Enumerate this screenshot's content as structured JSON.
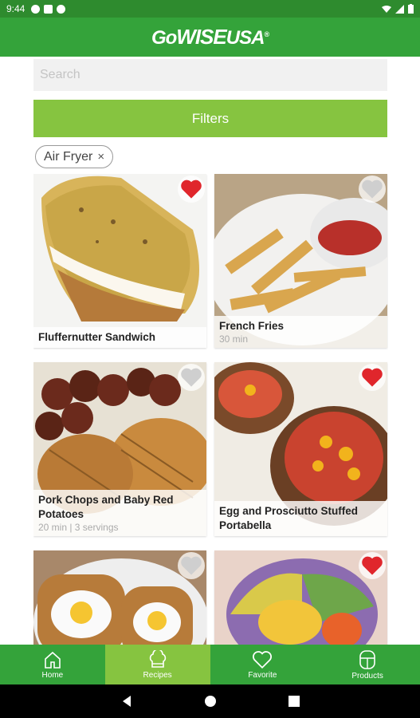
{
  "status": {
    "time": "9:44"
  },
  "app": {
    "logo_go": "Go",
    "logo_wise": "WISE",
    "logo_usa": "USA",
    "logo_mark": "®"
  },
  "search": {
    "placeholder": "Search"
  },
  "filters": {
    "label": "Filters"
  },
  "chip": {
    "label": "Air Fryer",
    "remove": "×"
  },
  "recipes": [
    {
      "title": "Fluffernutter Sandwich",
      "meta": "",
      "favorite": true,
      "icon": "heart-filled"
    },
    {
      "title": "French Fries",
      "meta": "30 min",
      "favorite": false,
      "icon": "heart-outline"
    },
    {
      "title": "Pork Chops and Baby Red Potatoes",
      "meta": "20 min | 3 servings",
      "favorite": false,
      "icon": "heart-outline"
    },
    {
      "title": "Egg and Prosciutto Stuffed Portabella",
      "meta": "",
      "favorite": true,
      "icon": "heart-filled"
    },
    {
      "title": "",
      "meta": "",
      "favorite": false,
      "icon": "heart-outline"
    },
    {
      "title": "",
      "meta": "",
      "favorite": true,
      "icon": "heart-filled"
    }
  ],
  "nav": {
    "items": [
      {
        "label": "Home",
        "icon": "home-icon"
      },
      {
        "label": "Recipes",
        "icon": "chef-hat-icon"
      },
      {
        "label": "Favorite",
        "icon": "heart-icon"
      },
      {
        "label": "Products",
        "icon": "air-fryer-icon"
      }
    ],
    "active": "Recipes"
  },
  "colors": {
    "primary": "#34a33a",
    "accent": "#86c440",
    "favorite": "#e0262c"
  }
}
